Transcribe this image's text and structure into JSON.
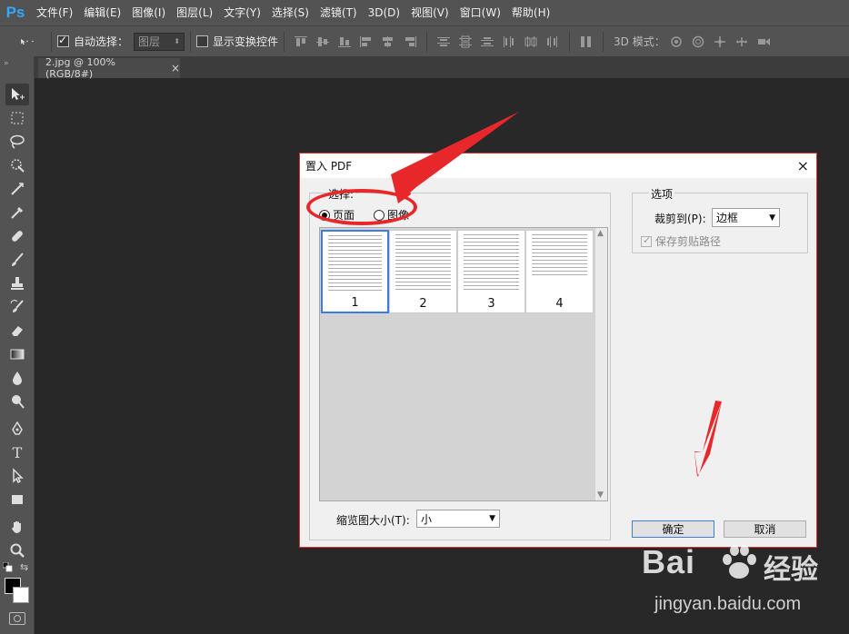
{
  "app": {
    "logo": "Ps"
  },
  "menu": [
    "文件(F)",
    "编辑(E)",
    "图像(I)",
    "图层(L)",
    "文字(Y)",
    "选择(S)",
    "滤镜(T)",
    "3D(D)",
    "视图(V)",
    "窗口(W)",
    "帮助(H)"
  ],
  "options_bar": {
    "auto_select_label": "自动选择：",
    "auto_select_checked": true,
    "auto_select_target": "图层",
    "show_transform_label": "显示变换控件",
    "show_transform_checked": false,
    "mode_3d_label": "3D 模式："
  },
  "document_tab": {
    "title": "2.jpg @ 100%(RGB/8#)",
    "close": "×"
  },
  "tools": [
    "move-tool",
    "marquee-tool",
    "lasso-tool",
    "quick-select-tool",
    "crop-tool",
    "eyedropper-tool",
    "healing-tool",
    "brush-tool",
    "stamp-tool",
    "history-brush-tool",
    "eraser-tool",
    "gradient-tool",
    "blur-tool",
    "dodge-tool",
    "pen-tool",
    "type-tool",
    "path-select-tool",
    "shape-tool",
    "hand-tool",
    "zoom-tool"
  ],
  "type_tool_glyph": "T",
  "dialog": {
    "title": "置入 PDF",
    "close": "×",
    "select_group": {
      "legend": "选择:",
      "radio_page": "页面",
      "radio_image": "图像",
      "selected": "page"
    },
    "pages": [
      {
        "number": "1",
        "selected": true
      },
      {
        "number": "2",
        "selected": false
      },
      {
        "number": "3",
        "selected": false
      },
      {
        "number": "4",
        "selected": false
      }
    ],
    "thumb_size_label": "缩览图大小(T):",
    "thumb_size_value": "小",
    "options_group": {
      "legend": "选项",
      "crop_label": "裁剪到(P):",
      "crop_value": "边框",
      "keep_clipping_label": "保存剪贴路径",
      "keep_clipping_checked": true,
      "keep_clipping_disabled": true
    },
    "ok_label": "确定",
    "cancel_label": "取消"
  },
  "watermark": {
    "logo": "Bai",
    "logo_suffix": "经验",
    "url": "jingyan.baidu.com"
  },
  "colors": {
    "annotation": "#e8272b",
    "accent": "#3d7de0",
    "ps_blue": "#31a8ff"
  }
}
